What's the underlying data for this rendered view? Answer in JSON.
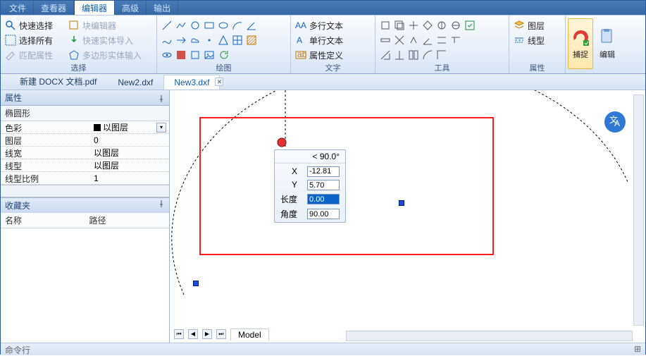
{
  "title_tabs": [
    "文件",
    "查看器",
    "编辑器",
    "高级",
    "输出"
  ],
  "title_active": 2,
  "ribbon": {
    "select": {
      "label": "选择",
      "items": [
        "快速选择",
        "选择所有",
        "匹配属性",
        "块编辑器",
        "快速实体导入",
        "多边形实体输入"
      ]
    },
    "draw": {
      "label": "绘图"
    },
    "text": {
      "label": "文字",
      "items": [
        "多行文本",
        "单行文本",
        "属性定义"
      ]
    },
    "tools": {
      "label": "工具"
    },
    "props": {
      "label": "属性",
      "items": [
        "图层",
        "线型"
      ]
    },
    "big": {
      "capture": "捕捉",
      "edit": "编辑"
    }
  },
  "doc_tabs": [
    "新建 DOCX 文档.pdf",
    "New2.dxf",
    "New3.dxf"
  ],
  "doc_active": 2,
  "panel": {
    "prop_title": "属性",
    "cat": "椭圆形",
    "rows": [
      {
        "k": "色彩",
        "v": "以图层",
        "swatch": true,
        "dd": true
      },
      {
        "k": "图层",
        "v": "0"
      },
      {
        "k": "线宽",
        "v": "以图层"
      },
      {
        "k": "线型",
        "v": "以图层"
      },
      {
        "k": "线型比例",
        "v": "1"
      }
    ],
    "fav_title": "收藏夹",
    "fav_cols": [
      "名称",
      "路径"
    ]
  },
  "floatbox": {
    "angle_hdr": "< 90.0°",
    "rows": [
      {
        "k": "X",
        "v": "-12.81"
      },
      {
        "k": "Y",
        "v": "5.70"
      },
      {
        "k": "长度",
        "v": "0.00",
        "sel": true
      },
      {
        "k": "角度",
        "v": "90.00"
      }
    ]
  },
  "model_tab": "Model",
  "cmdline": "命令行"
}
